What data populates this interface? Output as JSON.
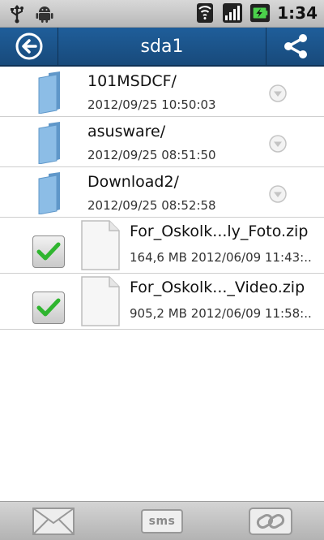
{
  "status_bar": {
    "icons": [
      "usb-icon",
      "android-debug-icon",
      "wifi-icon",
      "signal-icon",
      "battery-icon"
    ],
    "time": "1:34"
  },
  "title_bar": {
    "title": "sda1",
    "back_icon": "back-arrow-icon",
    "share_icon": "share-icon"
  },
  "folders": [
    {
      "name": "101MSDCF/",
      "date": "2012/09/25 10:50:03"
    },
    {
      "name": "asusware/",
      "date": "2012/09/25 08:51:50"
    },
    {
      "name": "Download2/",
      "date": "2012/09/25 08:52:58"
    }
  ],
  "files": [
    {
      "name": "For_Oskolk...ly_Foto.zip",
      "meta": "164,6 MB 2012/06/09 11:43:..",
      "checked": true
    },
    {
      "name": "For_Oskolk..._Video.zip",
      "meta": "905,2 MB 2012/06/09 11:58:..",
      "checked": true
    }
  ],
  "bottom_bar": {
    "mail_icon": "mail-icon",
    "sms_label": "sms",
    "link_icon": "link-icon"
  },
  "colors": {
    "title_bar": "#1f5e9a",
    "folder": "#7fb3e0",
    "checkmark": "#2fb52f"
  }
}
